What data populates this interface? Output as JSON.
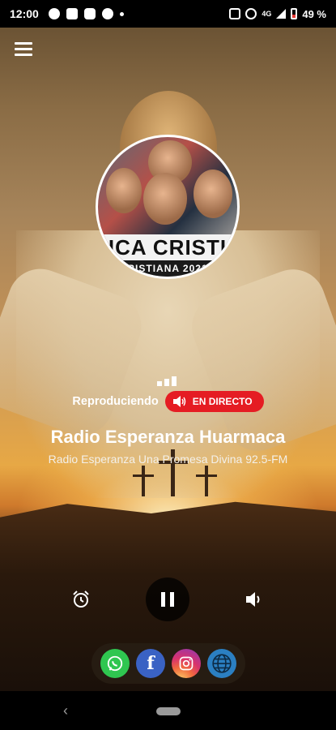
{
  "status_bar": {
    "time": "12:00",
    "network": "4G",
    "battery": "49 %",
    "icons": [
      "mic-icon",
      "message-icon",
      "youtube-icon",
      "sync-icon",
      "dot-icon",
      "wifi-calling-icon",
      "signal-icon",
      "battery-icon"
    ]
  },
  "header": {
    "menu_icon": "hamburger-menu-icon"
  },
  "album_art": {
    "banner_text": "ICA CRISTI",
    "sub_text": "RISTIANA 2021"
  },
  "player": {
    "status_label": "Reproduciendo",
    "live_label": "EN DIRECTO",
    "station_name": "Radio Esperanza Huarmaca",
    "slogan": "Radio Esperanza Una Promesa Divina 92.5-FM"
  },
  "controls": {
    "alarm_icon": "alarm-clock-icon",
    "pause_icon": "pause-icon",
    "volume_icon": "volume-icon"
  },
  "social": {
    "whatsapp_icon": "whatsapp-icon",
    "facebook_letter": "f",
    "instagram_icon": "instagram-icon",
    "web_icon": "globe-icon"
  },
  "colors": {
    "live_badge": "#e51c23",
    "whatsapp": "#2fc650",
    "facebook": "#3a62c4",
    "web": "#2b7fc2"
  }
}
